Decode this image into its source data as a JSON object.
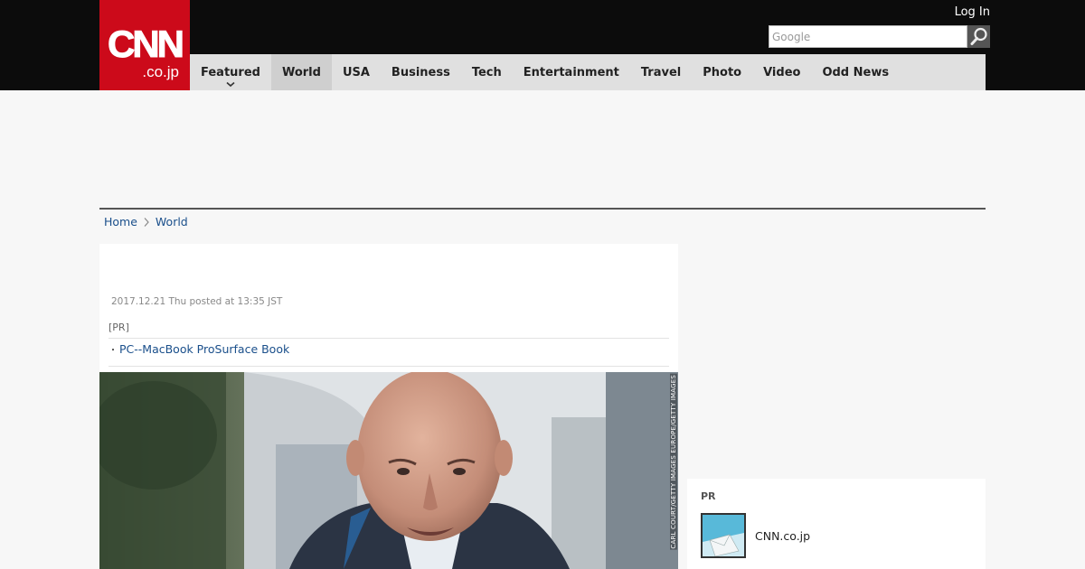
{
  "header": {
    "logo_main": "CNN",
    "logo_sub": ".co.jp",
    "login_label": "Log In",
    "search_placeholder": "Google",
    "brand_color": "#cc0a1a"
  },
  "nav": {
    "items": [
      {
        "label": "Featured"
      },
      {
        "label": "World"
      },
      {
        "label": "USA"
      },
      {
        "label": "Business"
      },
      {
        "label": "Tech"
      },
      {
        "label": "Entertainment"
      },
      {
        "label": "Travel"
      },
      {
        "label": "Photo"
      },
      {
        "label": "Video"
      },
      {
        "label": "Odd News"
      }
    ]
  },
  "breadcrumb": {
    "home": "Home",
    "current": "World"
  },
  "article": {
    "timestamp": "2017.12.21 Thu posted at 13:35 JST",
    "pr_label": "[PR]",
    "pr_bullet": "・",
    "pr_link": "PC--MacBook ProSurface Book",
    "photo_credit": "CARL COURT/GETTY IMAGES EUROPE/GETTY IMAGES"
  },
  "sidebar": {
    "label": "PR",
    "link": "CNN.co.jp"
  },
  "icons": {
    "search": "search-icon",
    "caret": "chevron-down-icon",
    "breadcrumb_sep": "chevron-right-icon"
  }
}
